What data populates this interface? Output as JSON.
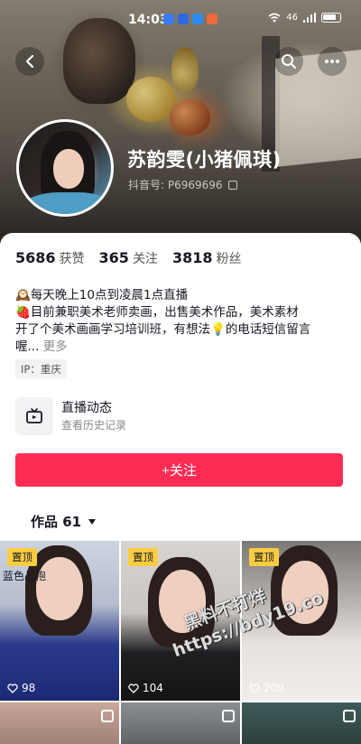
{
  "status_bar": {
    "time": "14:03",
    "signal": "46"
  },
  "profile": {
    "name": "苏韵雯(小猪佩琪)",
    "douyin_id": "抖音号: P6969696"
  },
  "stats": [
    {
      "value": "5686",
      "label": "获赞"
    },
    {
      "value": "365",
      "label": "关注"
    },
    {
      "value": "3818",
      "label": "粉丝"
    }
  ],
  "bio": {
    "line1": "每天晚上10点到凌晨1点直播",
    "line2": "目前兼职美术老师卖画，出售美术作品，美术素材",
    "line3": "开了个美术画画学习培训班，有想法",
    "line3b": "的电话短信留言",
    "line4": "喔...",
    "more": "更多"
  },
  "ip_tag": "IP：重庆",
  "live": {
    "title": "直播动态",
    "subtitle": "查看历史记录"
  },
  "follow_button": "+关注",
  "works_tab": "作品 61",
  "tiles": [
    {
      "badge": "置顶",
      "caption": "蓝色战袍",
      "likes": "98"
    },
    {
      "badge": "置顶",
      "likes": "104"
    },
    {
      "badge": "置顶",
      "likes": "209"
    }
  ],
  "watermark": {
    "line1": "黑料不打烊",
    "line2": "https://bdy19.co"
  },
  "colors": {
    "accent": "#fe2c55",
    "pin_badge": "#facd41"
  },
  "icons": [
    "back-icon",
    "search-icon",
    "more-icon",
    "copy-icon",
    "live-tv-icon",
    "heart-icon",
    "multi-image-icon"
  ]
}
